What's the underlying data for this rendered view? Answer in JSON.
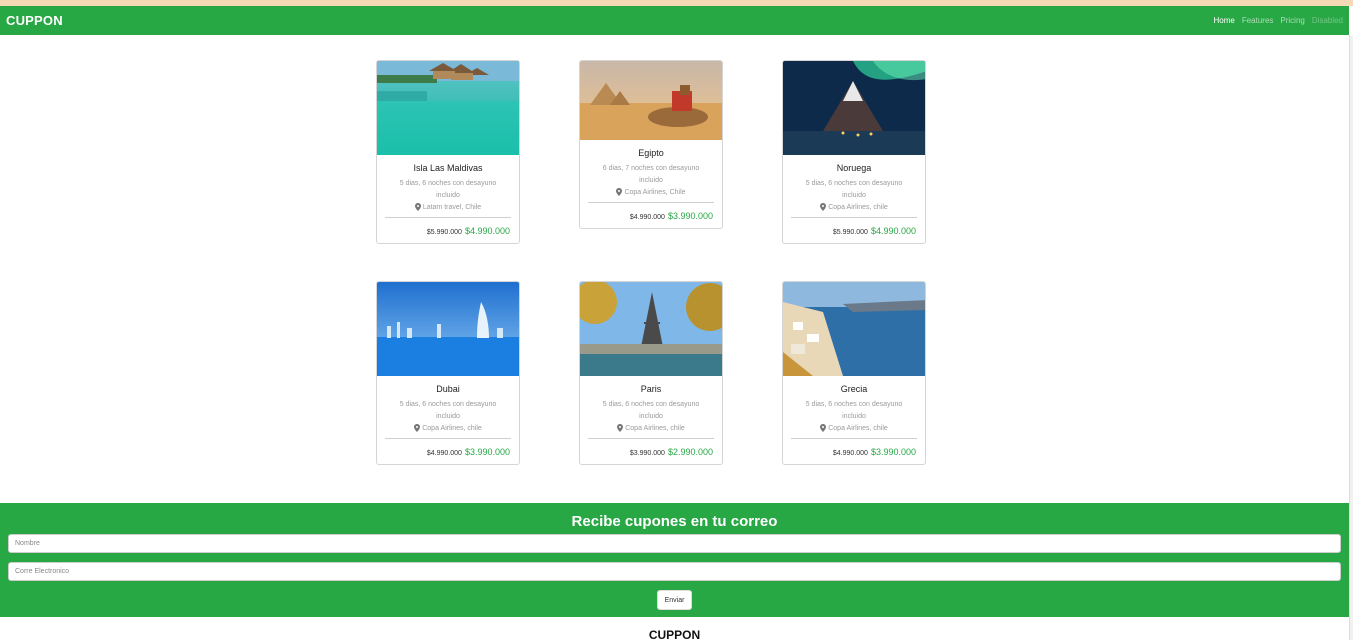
{
  "navbar": {
    "brand": "CUPPON",
    "links": [
      "Home",
      "Features",
      "Pricing",
      "Disabled"
    ]
  },
  "cards": [
    {
      "title": "Isla Las Maldivas",
      "desc": "5 dias, 6 noches con desayuno incluido",
      "location": "Latam travel, Chile",
      "old_price": "$5.990.000",
      "new_price": "$4.990.000",
      "image": "overwater-bungalows-photo"
    },
    {
      "title": "Egipto",
      "desc": "6 dias, 7 noches con desayuno incluido",
      "location": "Copa Airlines, Chile",
      "old_price": "$4.990.000",
      "new_price": "$3.990.000",
      "image": "pyramids-camel-photo"
    },
    {
      "title": "Noruega",
      "desc": "5 dias, 6 noches con desayuno incluido",
      "location": "Copa Airlines, chile",
      "old_price": "$5.990.000",
      "new_price": "$4.990.000",
      "image": "northern-lights-photo"
    },
    {
      "title": "Dubai",
      "desc": "5 dias, 6 noches con desayuno incluido",
      "location": "Copa Airlines, chile",
      "old_price": "$4.990.000",
      "new_price": "$3.990.000",
      "image": "dubai-skyline-photo"
    },
    {
      "title": "Paris",
      "desc": "5 dias, 6 noches con desayuno incluido",
      "location": "Copa Airlines, chile",
      "old_price": "$3.990.000",
      "new_price": "$2.990.000",
      "image": "eiffel-tower-photo"
    },
    {
      "title": "Grecia",
      "desc": "5 dias, 6 noches con desayuno incluido",
      "location": "Copa Airlines, chile",
      "old_price": "$4.990.000",
      "new_price": "$3.990.000",
      "image": "santorini-photo"
    }
  ],
  "subscribe": {
    "heading": "Recibe cupones en tu correo",
    "name_placeholder": "Nombre",
    "email_placeholder": "Corre Electronico",
    "button": "Enviar"
  },
  "footer": {
    "brand": "CUPPON"
  },
  "colors": {
    "accent": "#28a745",
    "topstrip": "#f5d9b5"
  }
}
